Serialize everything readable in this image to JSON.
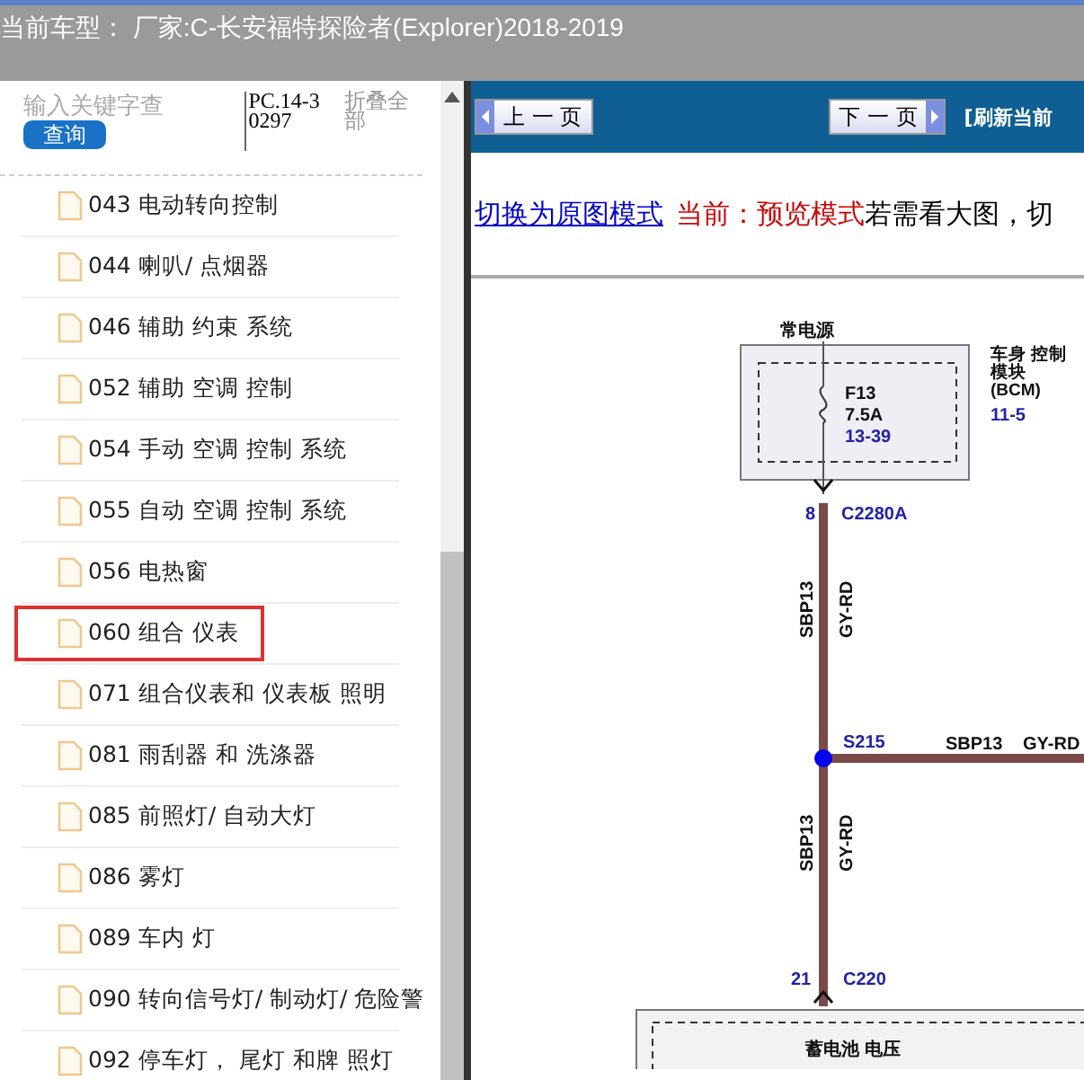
{
  "window": {
    "title": "当前车型： 厂家:C-长安福特探险者(Explorer)2018-2019"
  },
  "sidebar": {
    "search": {
      "placeholder": "输入关键字查"
    },
    "search_button": "查询",
    "code": "PC.14-30297",
    "collapse_all": "折叠全部",
    "items": [
      {
        "label": "043 电动转向控制",
        "selected": false
      },
      {
        "label": "044 喇叭/ 点烟器",
        "selected": false
      },
      {
        "label": "046 辅助 约束 系统",
        "selected": false
      },
      {
        "label": "052 辅助 空调 控制",
        "selected": false
      },
      {
        "label": "054 手动 空调 控制 系统",
        "selected": false
      },
      {
        "label": "055 自动 空调 控制 系统",
        "selected": false
      },
      {
        "label": "056 电热窗",
        "selected": false
      },
      {
        "label": "060 组合 仪表",
        "selected": true
      },
      {
        "label": "071 组合仪表和 仪表板 照明",
        "selected": false
      },
      {
        "label": "081 雨刮器 和 洗涤器",
        "selected": false
      },
      {
        "label": "085 前照灯/ 自动大灯",
        "selected": false
      },
      {
        "label": "086 雾灯",
        "selected": false
      },
      {
        "label": "089 车内 灯",
        "selected": false
      },
      {
        "label": "090 转向信号灯/ 制动灯/ 危险警",
        "selected": false
      },
      {
        "label": "092 停车灯， 尾灯 和牌 照灯",
        "selected": false
      }
    ]
  },
  "toolbar": {
    "prev_button": "上 一 页",
    "next_button": "下 一 页",
    "refresh_link": "[刷新当前"
  },
  "mode_bar": {
    "switch_link": "切换为原图模式",
    "current_mode": "当前：预览模式",
    "hint": "若需看大图，切"
  },
  "diagram": {
    "power_label": "常电源",
    "fuse": "F13",
    "fuse_rating": "7.5A",
    "fuse_ref": "13-39",
    "module_label": [
      "车身 控制",
      "模块",
      "(BCM)"
    ],
    "module_ref": "11-5",
    "top_pin": "8",
    "top_connector": "C2280A",
    "upper_circuit": "SBP13",
    "upper_color": "GY-RD",
    "splice": "S215",
    "branch_circuit": "SBP13",
    "branch_color": "GY-RD",
    "lower_circuit": "SBP13",
    "lower_color": "GY-RD",
    "bottom_pin": "21",
    "bottom_connector": "C220",
    "battery_label": "蓄电池 电压"
  }
}
